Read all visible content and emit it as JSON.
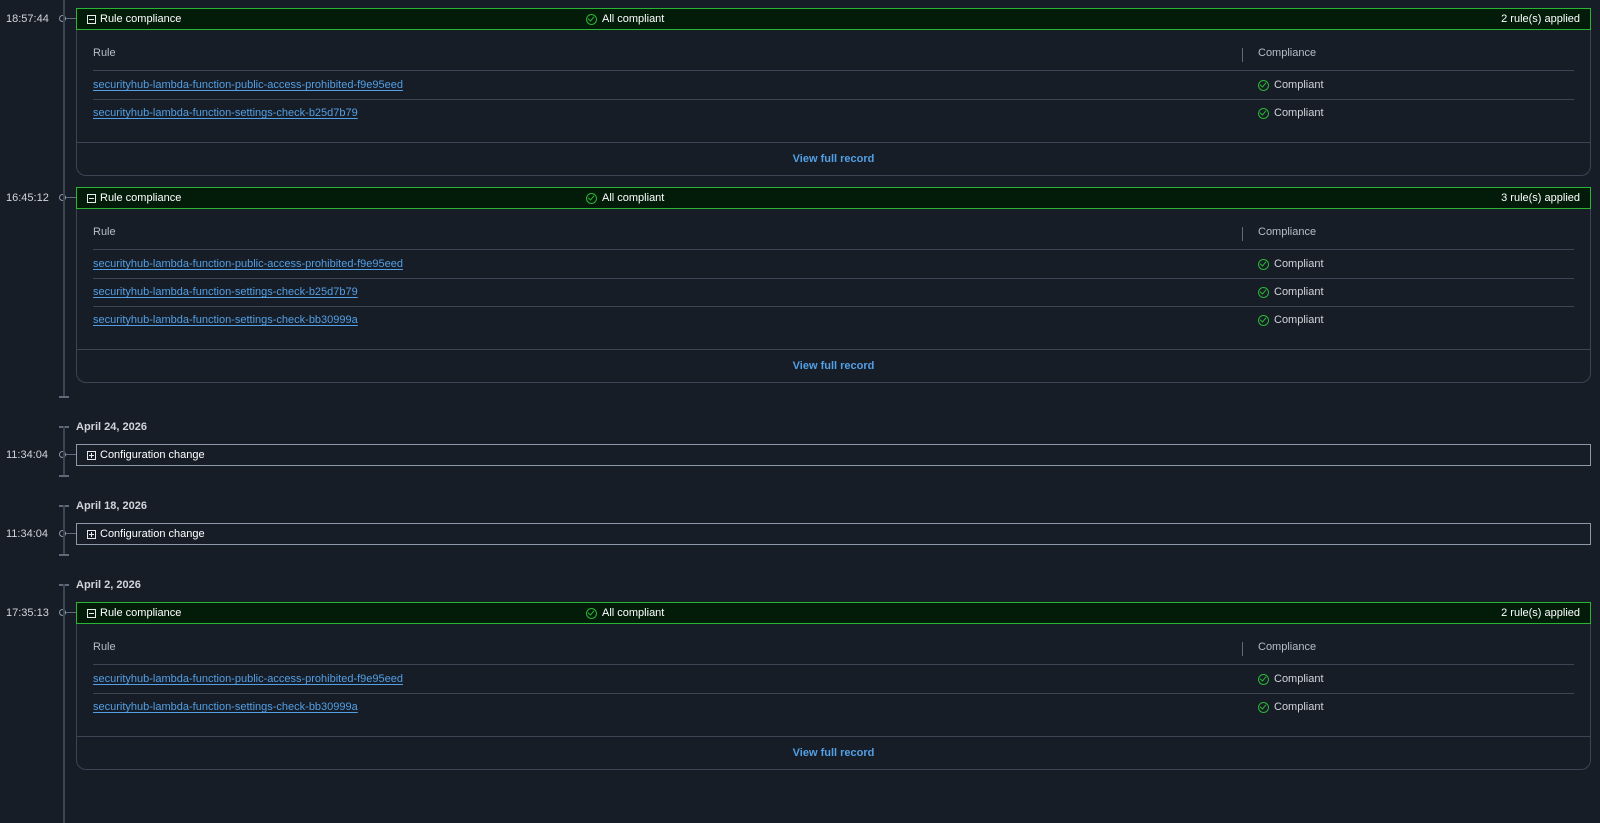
{
  "colors": {
    "background": "#161d26",
    "compliant_green": "#2bb534",
    "compliant_header_bg": "#031c0a",
    "link_blue": "#539fe5",
    "border": "#3b4553"
  },
  "icons": {
    "collapse": "minus-square-icon",
    "expand": "plus-square-icon",
    "compliant": "check-circle-icon"
  },
  "table_headers": {
    "rule": "Rule",
    "compliance": "Compliance"
  },
  "view_full_record_label": "View full record",
  "entries": [
    {
      "kind": "rule_compliance",
      "time": "18:57:44",
      "title": "Rule compliance",
      "status": "All compliant",
      "count": "2 rule(s) applied",
      "expanded": true,
      "rules": [
        {
          "name": "securityhub-lambda-function-public-access-prohibited-f9e95eed",
          "compliance": "Compliant"
        },
        {
          "name": "securityhub-lambda-function-settings-check-b25d7b79",
          "compliance": "Compliant"
        }
      ]
    },
    {
      "kind": "rule_compliance",
      "time": "16:45:12",
      "title": "Rule compliance",
      "status": "All compliant",
      "count": "3 rule(s) applied",
      "expanded": true,
      "rules": [
        {
          "name": "securityhub-lambda-function-public-access-prohibited-f9e95eed",
          "compliance": "Compliant"
        },
        {
          "name": "securityhub-lambda-function-settings-check-b25d7b79",
          "compliance": "Compliant"
        },
        {
          "name": "securityhub-lambda-function-settings-check-bb30999a",
          "compliance": "Compliant"
        }
      ]
    },
    {
      "kind": "configuration_change",
      "date": "April 24, 2026",
      "time": "11:34:04",
      "title": "Configuration change",
      "expanded": false
    },
    {
      "kind": "configuration_change",
      "date": "April 18, 2026",
      "time": "11:34:04",
      "title": "Configuration change",
      "expanded": false
    },
    {
      "kind": "rule_compliance",
      "date": "April 2, 2026",
      "time": "17:35:13",
      "title": "Rule compliance",
      "status": "All compliant",
      "count": "2 rule(s) applied",
      "expanded": true,
      "rules": [
        {
          "name": "securityhub-lambda-function-public-access-prohibited-f9e95eed",
          "compliance": "Compliant"
        },
        {
          "name": "securityhub-lambda-function-settings-check-bb30999a",
          "compliance": "Compliant"
        }
      ]
    }
  ]
}
